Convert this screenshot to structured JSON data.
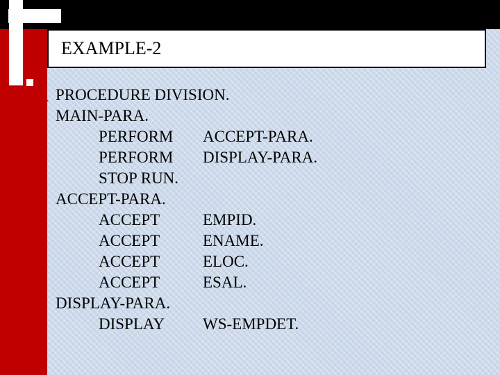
{
  "title": "EXAMPLE-2",
  "code": {
    "l1": "PROCEDURE DIVISION.",
    "l2": "MAIN-PARA.",
    "l3k": "PERFORM",
    "l3a": "ACCEPT-PARA.",
    "l4k": "PERFORM",
    "l4a": "DISPLAY-PARA.",
    "l5k": "STOP RUN.",
    "l6": "ACCEPT-PARA.",
    "l7k": "ACCEPT",
    "l7a": "EMPID.",
    "l8k": "ACCEPT",
    "l8a": "ENAME.",
    "l9k": "ACCEPT",
    "l9a": "ELOC.",
    "l10k": "ACCEPT",
    "l10a": "ESAL.",
    "l11": "DISPLAY-PARA.",
    "l12k": "DISPLAY",
    "l12a": "WS-EMPDET."
  }
}
